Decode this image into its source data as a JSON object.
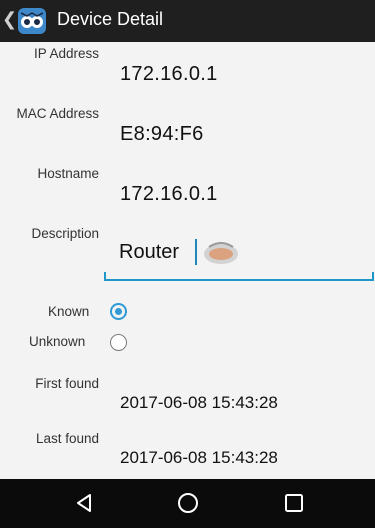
{
  "app_bar": {
    "back_icon": "chevron-left-icon",
    "logo_icon": "owl-eyes-logo-icon",
    "title": "Device Detail"
  },
  "fields": {
    "ip_label": "IP Address",
    "ip_value": "172.16.0.1",
    "mac_label": "MAC Address",
    "mac_value": "E8:94:F6",
    "hostname_label": "Hostname",
    "hostname_value": "172.16.0.1",
    "description_label": "Description",
    "description_value": "Router"
  },
  "status": {
    "known_label": "Known",
    "unknown_label": "Unknown",
    "selected": "Known"
  },
  "found": {
    "first_label": "First found",
    "first_value": "2017-06-08 15:43:28",
    "last_label": "Last found",
    "last_value": "2017-06-08 15:43:28"
  },
  "nav_bar": {
    "back_icon": "triangle-back-icon",
    "home_icon": "circle-home-icon",
    "recents_icon": "square-recents-icon"
  },
  "colors": {
    "accent": "#2196c9",
    "app_bar": "#1f1f1f",
    "nav_bar": "#0b0b0b"
  }
}
